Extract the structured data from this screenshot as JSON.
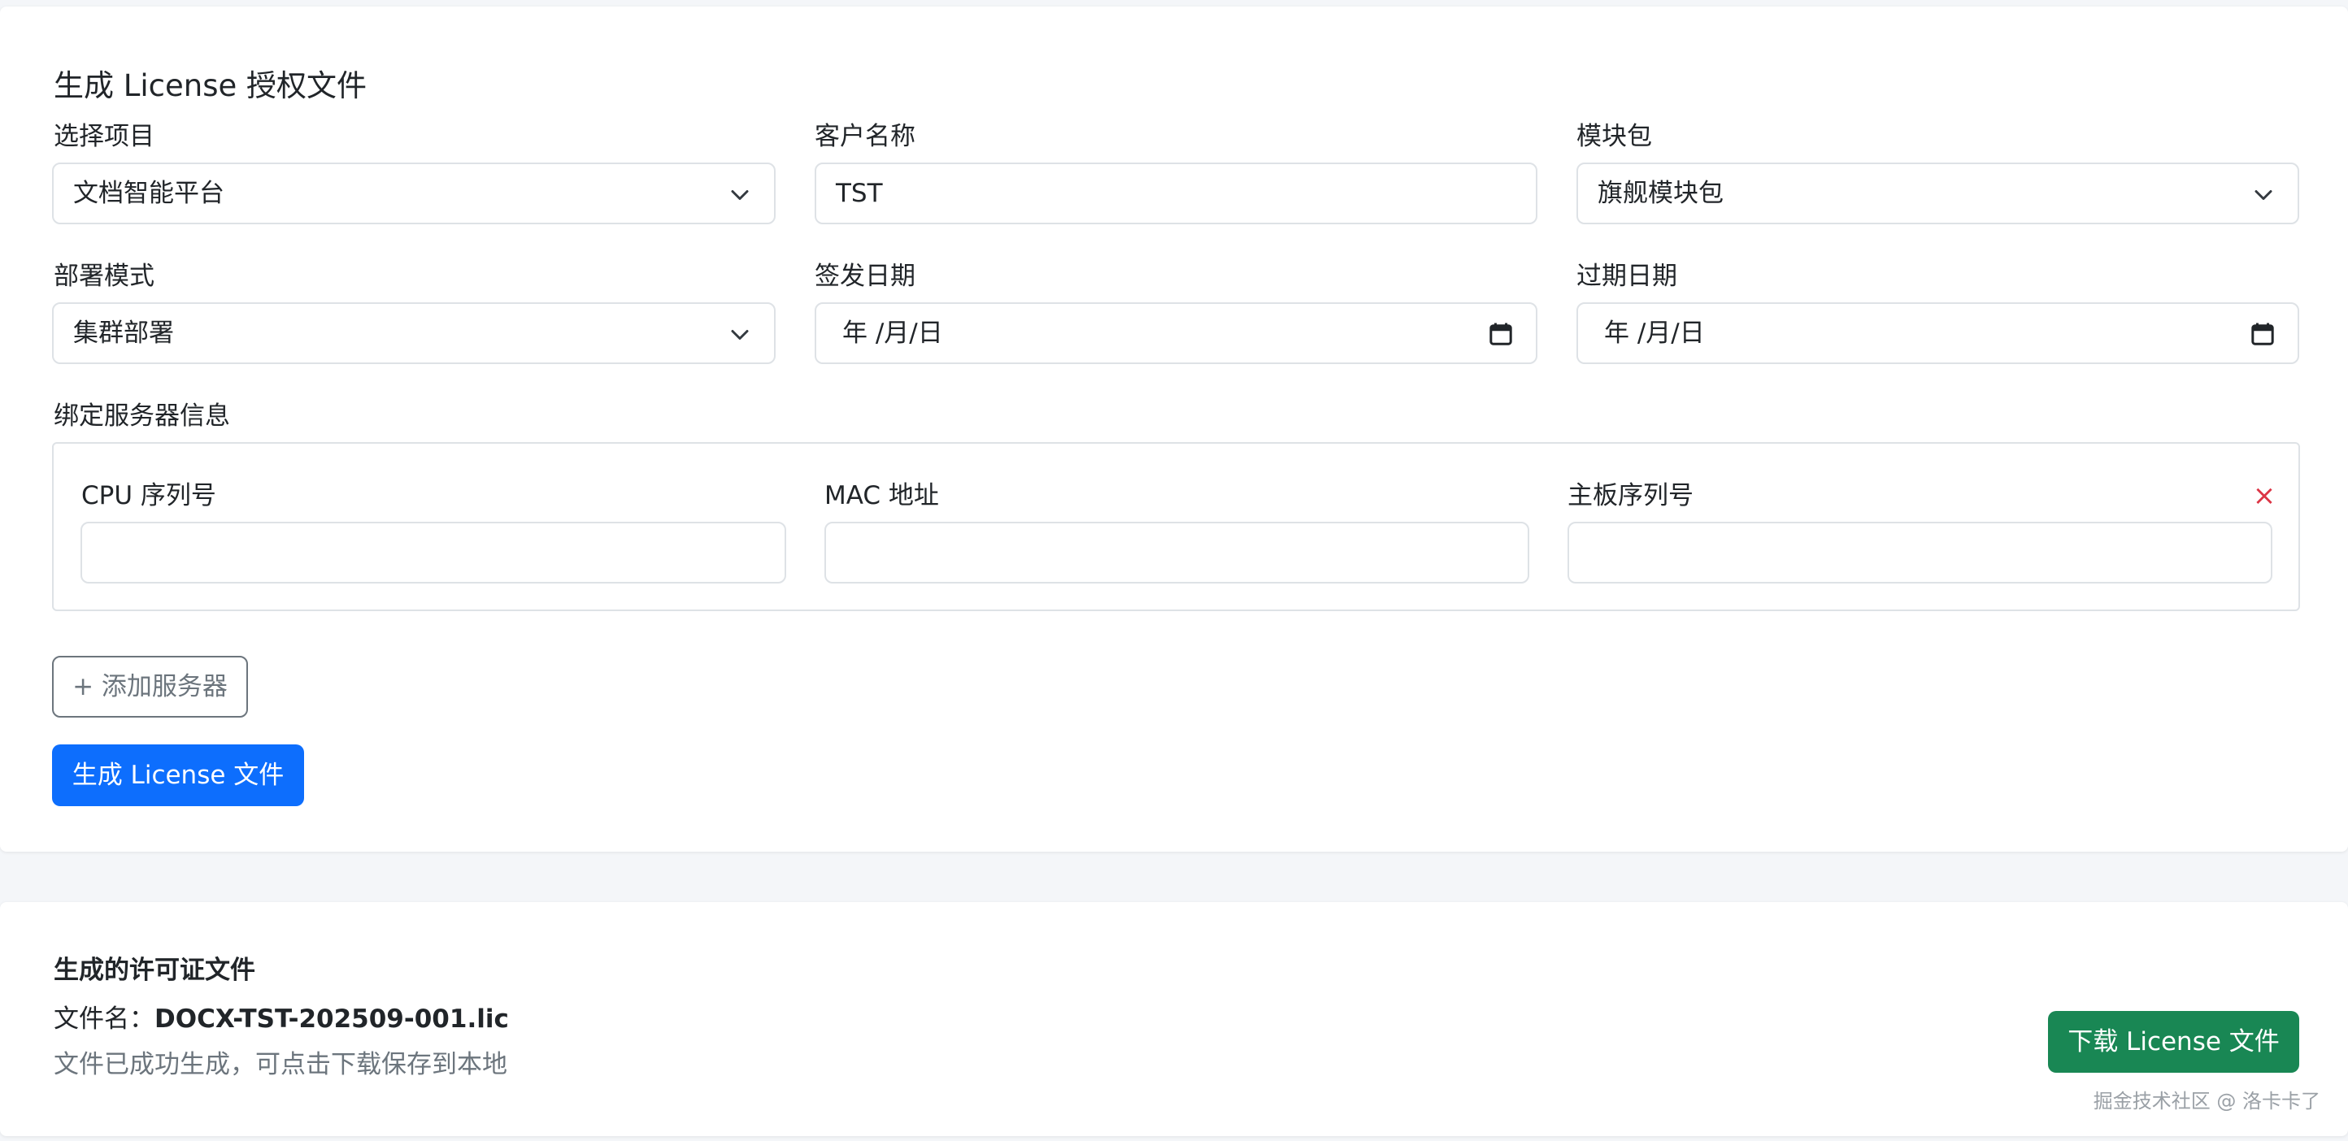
{
  "form": {
    "title": "生成 License 授权文件",
    "project": {
      "label": "选择项目",
      "value": "文档智能平台"
    },
    "customer": {
      "label": "客户名称",
      "value": "TST"
    },
    "module": {
      "label": "模块包",
      "value": "旗舰模块包"
    },
    "deploy": {
      "label": "部署模式",
      "value": "集群部署"
    },
    "issue_date": {
      "label": "签发日期",
      "value": "年 /月/日"
    },
    "expire_date": {
      "label": "过期日期",
      "value": "年 /月/日"
    },
    "servers": {
      "label": "绑定服务器信息",
      "cpu_label": "CPU 序列号",
      "mac_label": "MAC 地址",
      "board_label": "主板序列号",
      "remove_symbol": "×",
      "cpu_value": "",
      "mac_value": "",
      "board_value": ""
    },
    "add_server_label": "+ 添加服务器",
    "generate_label": "生成 License 文件"
  },
  "result": {
    "title": "生成的许可证文件",
    "file_prefix": "文件名：",
    "file_name": "DOCX-TST-202509-001.lic",
    "hint": "文件已成功生成，可点击下载保存到本地",
    "download_label": "下载 License 文件"
  },
  "watermark": "掘金技术社区 @ 洛卡卡了",
  "colors": {
    "primary": "#0d6efd",
    "success": "#198754",
    "danger": "#dc3545",
    "border": "#dee2e6",
    "muted": "#6c757d",
    "page_bg": "#f4f6f9"
  }
}
